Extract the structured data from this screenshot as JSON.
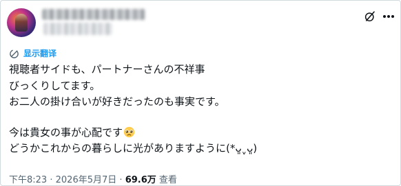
{
  "author": {
    "avatar_icon": "user-avatar",
    "display_name_redacted": true,
    "handle_redacted": true
  },
  "header_actions": {
    "grok_icon": "grok-icon",
    "more_icon": "more-icon"
  },
  "translate": {
    "icon": "translate-icon",
    "label": "显示翻译"
  },
  "tweet": {
    "lines": [
      "視聴者サイドも、パートナーさんの不祥事",
      "びっくりしてます。",
      "お二人の掛け合いが好きだったのも事実です。",
      "今は貴女の事が心配です",
      "どうかこれからの暮らしに光がありますように(*ᴗ͈ˬᴗ͈)"
    ],
    "emoji_icon": "pleading-face-emoji"
  },
  "meta": {
    "time": "下午8:23",
    "separator": "·",
    "date": "2026年5月7日",
    "views_count": "69.6万",
    "views_label": "查看"
  },
  "colors": {
    "link": "#1d9bf0",
    "text": "#0f1419",
    "secondary": "#536471",
    "border": "#cfd9de"
  }
}
